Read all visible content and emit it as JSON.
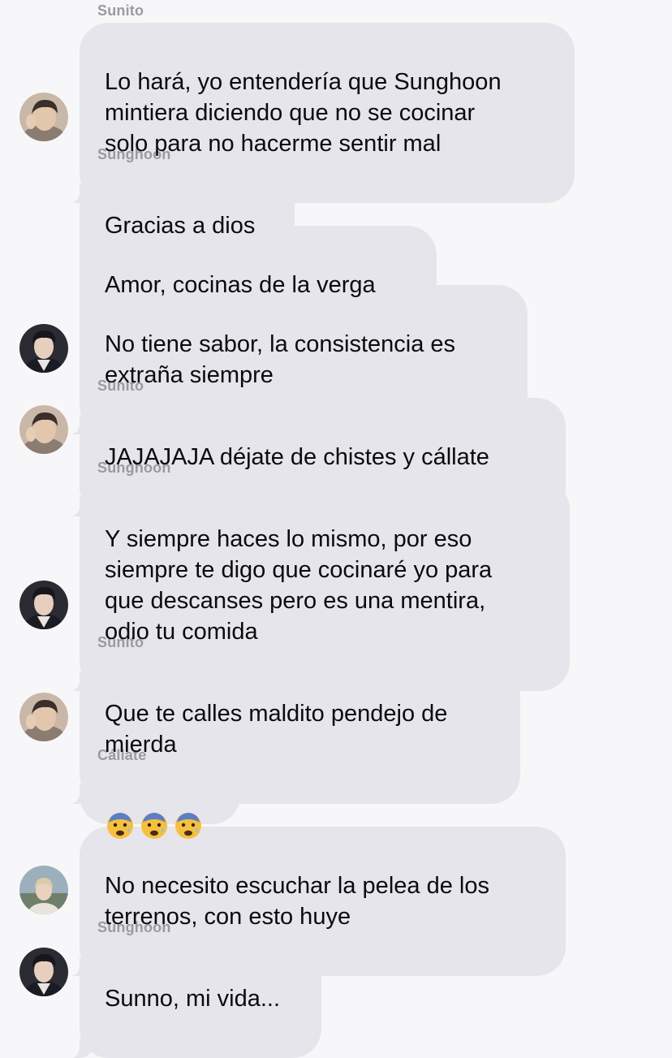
{
  "messages": [
    {
      "sender": "Sunito",
      "bubbles": [
        "Lo hará, yo entendería que Sunghoon\nmintiera diciendo que no se cocinar\nsolo para no hacerme sentir mal"
      ]
    },
    {
      "sender": "Sunghoon",
      "bubbles": [
        "Gracias a dios",
        "Amor, cocinas de la verga",
        "No tiene sabor, la consistencia es\nextraña siempre"
      ]
    },
    {
      "sender": "Sunito",
      "bubbles": [
        "JAJAJAJA déjate de chistes y cállate"
      ]
    },
    {
      "sender": "Sunghoon",
      "bubbles": [
        "Y siempre haces lo mismo, por eso\nsiempre te digo que cocinaré yo para\nque descanses pero es una mentira,\nodio tu comida"
      ]
    },
    {
      "sender": "Sunito",
      "bubbles": [
        "Que te calles maldito pendejo de\nmierda"
      ]
    },
    {
      "sender": "Cállate",
      "bubbles": [],
      "emoji": [
        "anxious-face-with-sweat",
        "anxious-face-with-sweat",
        "anxious-face-with-sweat"
      ]
    },
    {
      "sender": "",
      "bubbles": [
        "No necesito escuchar la pelea de los\nterrenos, con esto huye"
      ]
    },
    {
      "sender": "Sunghoon",
      "bubbles": [
        "Sunno, mi vida..."
      ]
    }
  ],
  "avatars": {
    "sunito": "avatar-sunito",
    "sunghoon": "avatar-sunghoon",
    "third": "avatar-third"
  },
  "colors": {
    "background": "#f7f7f9",
    "bubble": "#e6e5eb",
    "sender_label": "#9a9aa0",
    "text": "#0b0b0d"
  }
}
